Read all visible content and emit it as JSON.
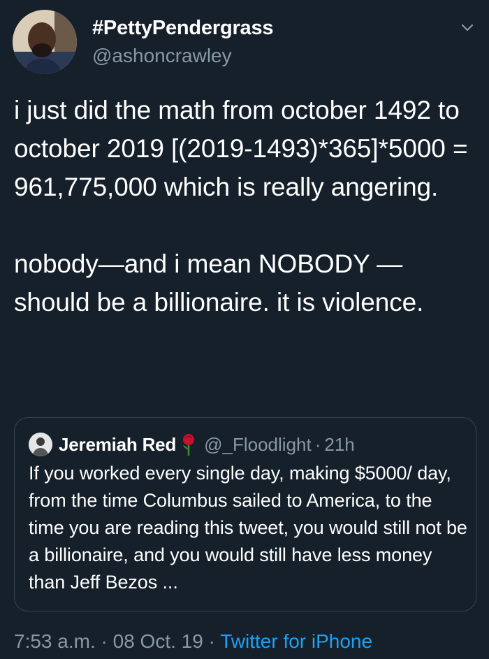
{
  "author": {
    "display_name": "#PettyPendergrass",
    "handle": "@ashoncrawley"
  },
  "tweet": {
    "text": "i just did the math from october 1492 to october 2019 [(2019-1493)*365]*5000 = 961,775,000 which is really angering.\n\nnobody—and i mean NOBODY —should be a billionaire. it is violence."
  },
  "quoted_tweet": {
    "display_name": "Jeremiah Red",
    "name_emoji": "rose-icon",
    "handle": "@_Floodlight",
    "separator": "·",
    "time": "21h",
    "text": "If you worked every single day, making $5000/ day, from the time Columbus sailed to America, to the time you are reading this tweet, you would still not be a billionaire, and you would still have less money than Jeff Bezos ..."
  },
  "footer": {
    "time": "7:53 a.m.",
    "separator": "·",
    "date": "08 Oct. 19",
    "source": "Twitter for iPhone"
  },
  "colors": {
    "background": "#15202b",
    "secondary_text": "#8899a6",
    "link": "#1da1f2",
    "border": "#38444d"
  },
  "icons": [
    "avatar",
    "chevron-down-icon",
    "quote-avatar",
    "rose-icon"
  ]
}
